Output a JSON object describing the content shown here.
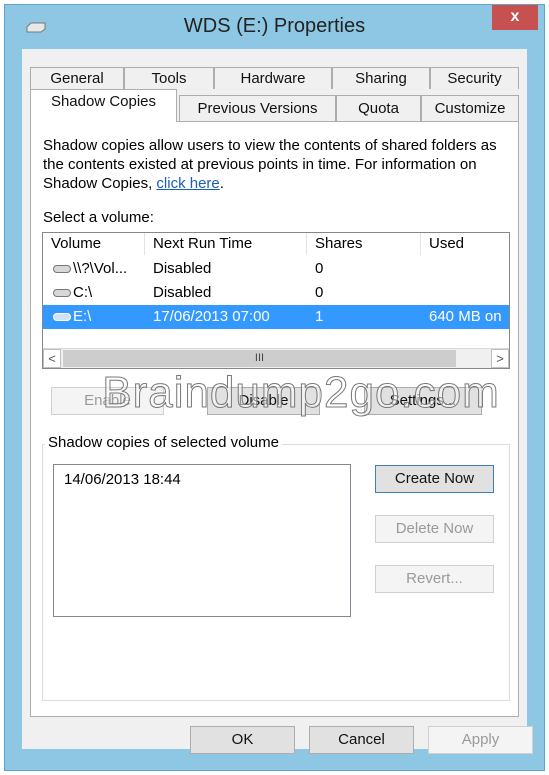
{
  "window": {
    "title": "WDS (E:) Properties",
    "close_label": "x"
  },
  "tabs_row1": [
    "General",
    "Tools",
    "Hardware",
    "Sharing",
    "Security"
  ],
  "tabs_row2": [
    "Shadow Copies",
    "Previous Versions",
    "Quota",
    "Customize"
  ],
  "active_tab": "Shadow Copies",
  "description": {
    "text": "Shadow copies allow users to view the contents of shared folders as the contents existed at previous points in time. For information on Shadow Copies,",
    "link": "click here",
    "suffix": "."
  },
  "volume_section": {
    "label": "Select a volume:",
    "columns": [
      "Volume",
      "Next Run Time",
      "Shares",
      "Used"
    ],
    "rows": [
      {
        "volume": "\\\\?\\Vol...",
        "next_run": "Disabled",
        "shares": "0",
        "used": "",
        "icon": "drive-icon",
        "selected": false
      },
      {
        "volume": "C:\\",
        "next_run": "Disabled",
        "shares": "0",
        "used": "",
        "icon": "drive-icon",
        "selected": false
      },
      {
        "volume": "E:\\",
        "next_run": "17/06/2013 07:00",
        "shares": "1",
        "used": "640 MB on",
        "icon": "drive-icon",
        "selected": true
      }
    ],
    "scrollbar": {
      "left": "<",
      "thumb": "III",
      "right": ">"
    }
  },
  "volume_buttons": {
    "enable": "Enable",
    "disable": "Disable",
    "settings": "Settings..."
  },
  "watermark": "Braindump2go.com",
  "shadow_group": {
    "title": "Shadow copies of selected volume",
    "items": [
      "14/06/2013 18:44"
    ],
    "create_now": "Create Now",
    "delete_now": "Delete Now",
    "revert": "Revert..."
  },
  "dialog_buttons": {
    "ok": "OK",
    "cancel": "Cancel",
    "apply": "Apply"
  },
  "colors": {
    "title_bar": "#8ec7e3",
    "close_button": "#c75050",
    "selection": "#3399ff",
    "link": "#1a5fb4"
  }
}
